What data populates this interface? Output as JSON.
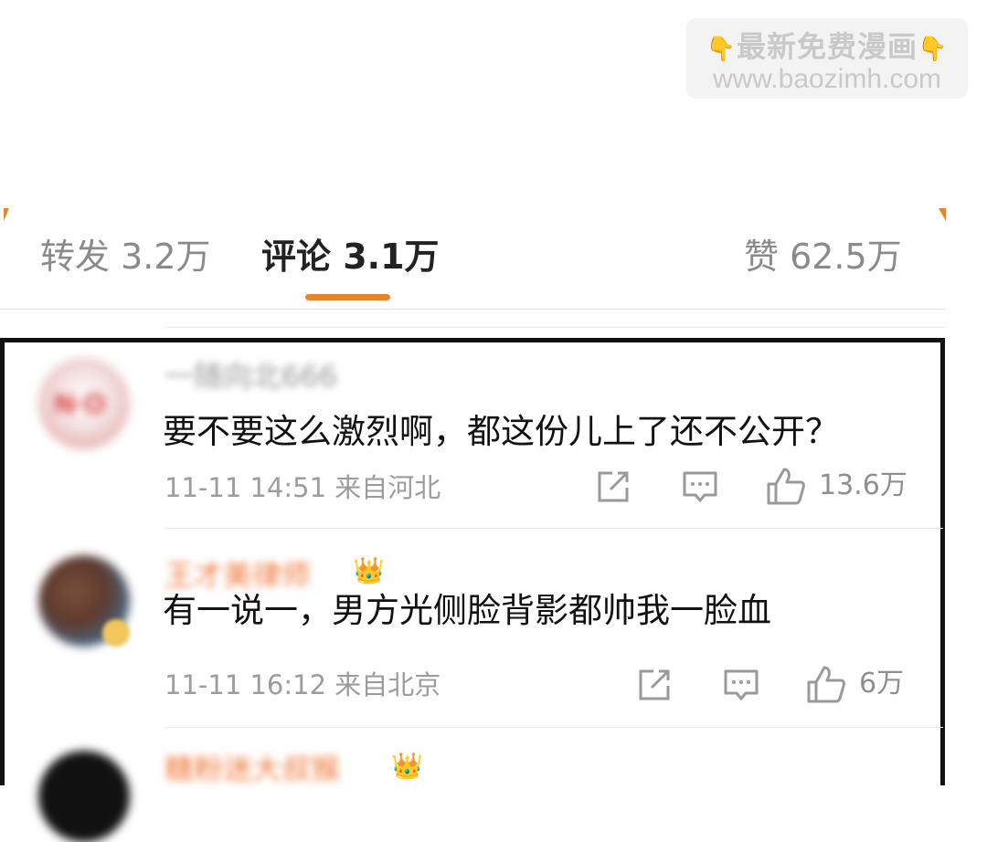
{
  "watermark": {
    "line1": "最新免费漫画",
    "line2": "www.baozimh.com"
  },
  "tabs": {
    "repost": "转发 3.2万",
    "comment": "评论 3.1万",
    "like": "赞 62.5万"
  },
  "comments": [
    {
      "username": "一随向北666",
      "text": "要不要这么激烈啊，都这份儿上了还不公开？",
      "meta": "11-11 14:51 来自河北",
      "likes": "13.6万"
    },
    {
      "username": "王才美律师",
      "text": "有一说一，男方光侧脸背影都帅我一脸血",
      "meta": "11-11 16:12 来自北京",
      "likes": "6万"
    },
    {
      "username": "糖粉迷大叔猴"
    }
  ],
  "colors": {
    "accent": "#e8852a",
    "frame": "#111111"
  },
  "icons": [
    "hand-pointing-icon",
    "share-icon",
    "reply-icon",
    "thumbs-up-icon",
    "crown-icon"
  ]
}
